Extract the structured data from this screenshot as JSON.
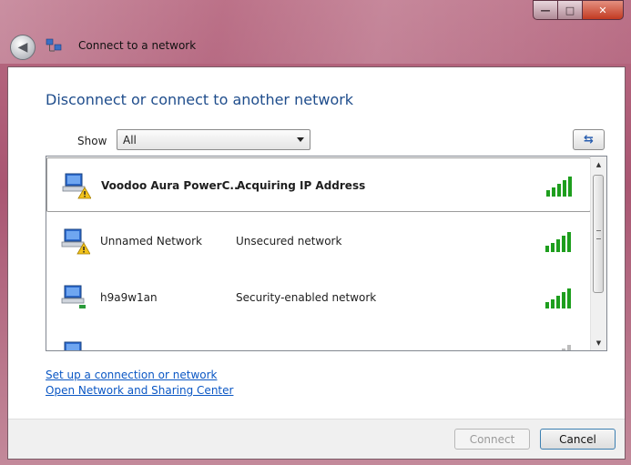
{
  "window": {
    "title": "Connect to a network",
    "minimize_glyph": "—",
    "maximize_glyph": "□",
    "close_glyph": "✕",
    "back_glyph": "◀"
  },
  "main": {
    "heading": "Disconnect or connect to another network",
    "show_label": "Show",
    "show_value": "All",
    "refresh_glyph": "⇆"
  },
  "networks": [
    {
      "name": "Voodoo Aura PowerC...",
      "status": "Acquiring IP Address",
      "selected": true,
      "icon": "network-warning-icon",
      "signal": "signal-bars-icon"
    },
    {
      "name": "Unnamed Network",
      "status": "Unsecured network",
      "selected": false,
      "icon": "network-warning-icon",
      "signal": "signal-bars-icon"
    },
    {
      "name": "h9a9w1an",
      "status": "Security-enabled network",
      "selected": false,
      "icon": "network-icon",
      "signal": "signal-bars-icon"
    }
  ],
  "links": {
    "setup": "Set up a connection or network",
    "center": "Open Network and Sharing Center"
  },
  "buttons": {
    "connect": "Connect",
    "cancel": "Cancel"
  },
  "colors": {
    "heading": "#1f4d8c",
    "link": "#0b57c4",
    "signal": "#1e9e1e",
    "frame": "#a95672"
  }
}
